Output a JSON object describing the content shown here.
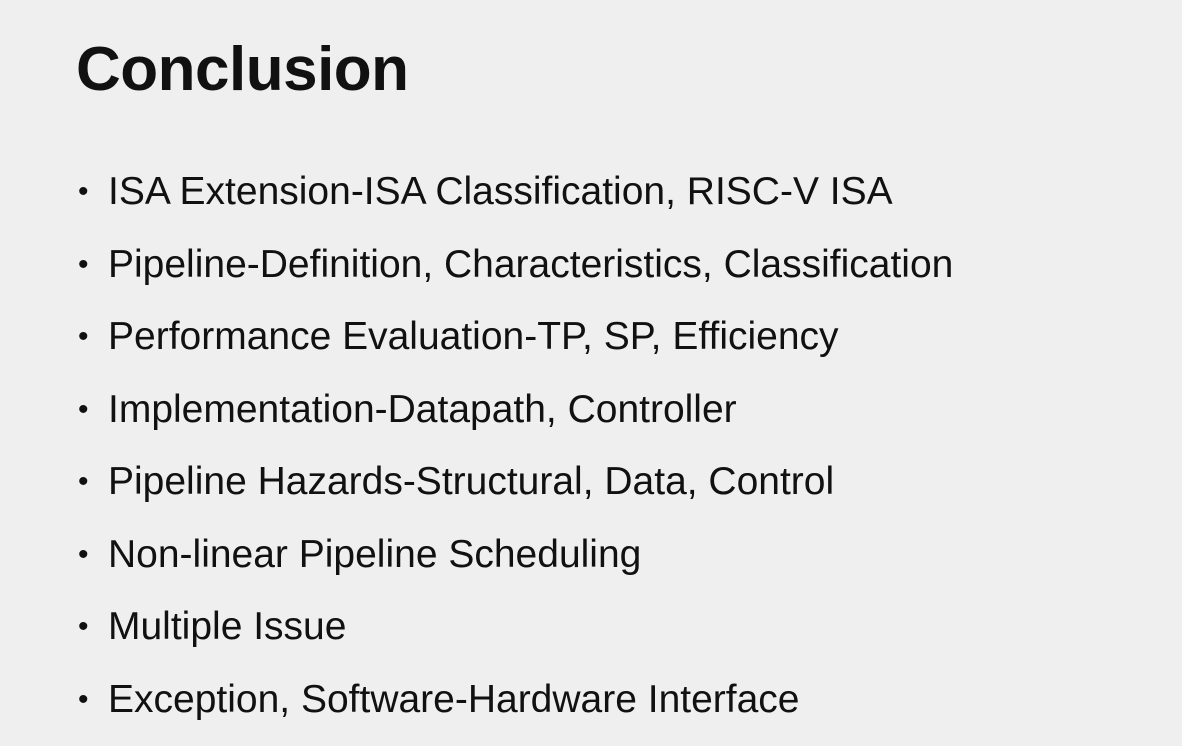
{
  "slide": {
    "title": "Conclusion",
    "bullets": [
      "ISA Extension-ISA Classification, RISC-V ISA",
      "Pipeline-Definition, Characteristics, Classification",
      "Performance Evaluation-TP, SP, Efficiency",
      "Implementation-Datapath, Controller",
      "Pipeline Hazards-Structural, Data, Control",
      "Non-linear Pipeline Scheduling",
      "Multiple Issue",
      "Exception, Software-Hardware Interface"
    ]
  },
  "colors": {
    "background": "#efefef",
    "text": "#111111"
  }
}
